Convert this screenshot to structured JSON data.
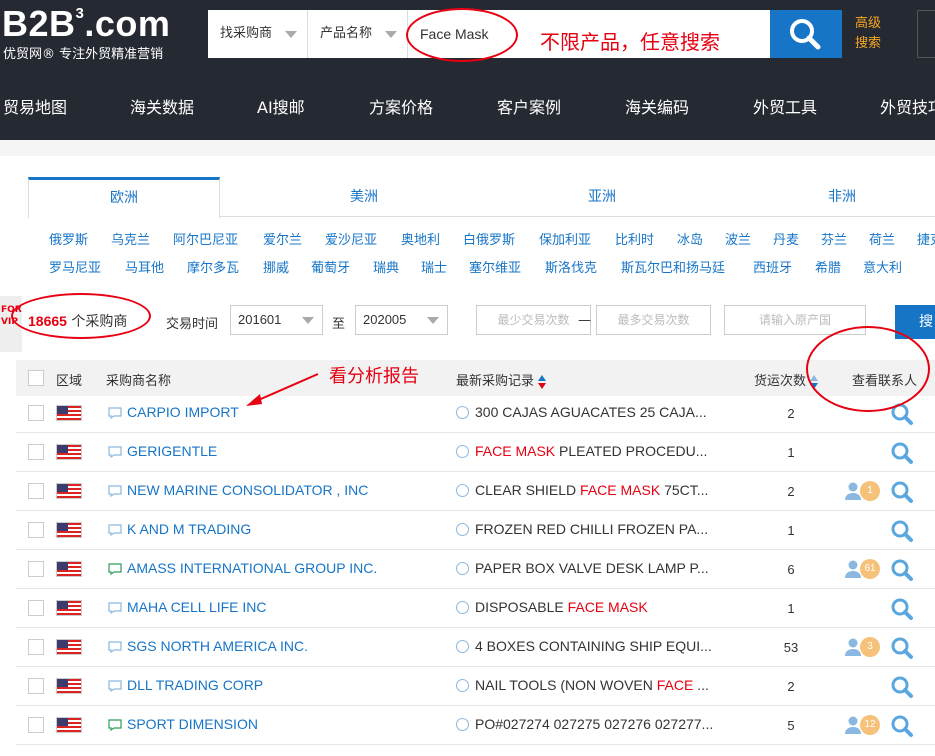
{
  "header": {
    "logo": "B2B",
    "logo_sup": "3",
    "logo_suffix": ".com",
    "logo_sub": "优贸网® 专注外贸精准营销",
    "search_type": "找采购商",
    "search_field": "产品名称",
    "search_query": "Face Mask",
    "callout": "不限产品，任意搜索",
    "advanced_search_line1": "高级",
    "advanced_search_line2": "搜索"
  },
  "nav": [
    "贸易地图",
    "海关数据",
    "AI搜邮",
    "方案价格",
    "客户案例",
    "海关编码",
    "外贸工具",
    "外贸技巧"
  ],
  "region_tabs": [
    "欧洲",
    "美洲",
    "亚洲",
    "非洲"
  ],
  "countries_row1": [
    "俄罗斯",
    "乌克兰",
    "阿尔巴尼亚",
    "爱尔兰",
    "爱沙尼亚",
    "奥地利",
    "白俄罗斯",
    "保加利亚",
    "比利时",
    "冰岛",
    "波兰",
    "丹麦",
    "芬兰",
    "荷兰",
    "捷克"
  ],
  "countries_row2": [
    "罗马尼亚",
    "马耳他",
    "摩尔多瓦",
    "挪威",
    "葡萄牙",
    "瑞典",
    "瑞士",
    "塞尔维亚",
    "斯洛伐克",
    "斯瓦尔巴和扬马廷",
    "西班牙",
    "希腊",
    "意大利"
  ],
  "filters": {
    "vip_line1": "FOR",
    "vip_line2": "VIP",
    "count": "18665",
    "count_unit": "个采购商",
    "time_label": "交易时间",
    "from": "201601",
    "to_label": "至",
    "to": "202005",
    "min_placeholder": "最少交易次数",
    "dash": "—",
    "max_placeholder": "最多交易次数",
    "country_placeholder": "请输入原产国",
    "search_btn": "搜"
  },
  "table": {
    "columns": [
      "区域",
      "采购商名称",
      "最新采购记录",
      "货运次数",
      "查看联系人"
    ],
    "annotation": "看分析报告",
    "rows": [
      {
        "buyer": "CARPIO IMPORT",
        "rec_pre": "300 CAJAS AGUACATES 25 CAJA...",
        "rec_red": "",
        "rec_post": "",
        "shipments": "2",
        "contacts": ""
      },
      {
        "buyer": "GERIGENTLE",
        "rec_pre": "",
        "rec_red": "FACE MASK",
        "rec_post": " PLEATED PROCEDU...",
        "shipments": "1",
        "contacts": ""
      },
      {
        "buyer": "NEW MARINE CONSOLIDATOR , INC",
        "rec_pre": "CLEAR SHIELD ",
        "rec_red": "FACE MASK",
        "rec_post": " 75CT...",
        "shipments": "2",
        "contacts": "1"
      },
      {
        "buyer": "K AND M TRADING",
        "rec_pre": "FROZEN RED CHILLI FROZEN PA...",
        "rec_red": "",
        "rec_post": "",
        "shipments": "1",
        "contacts": ""
      },
      {
        "buyer": "AMASS INTERNATIONAL GROUP INC.",
        "rec_pre": "PAPER BOX VALVE DESK LAMP P...",
        "rec_red": "",
        "rec_post": "",
        "shipments": "6",
        "contacts": "61"
      },
      {
        "buyer": "MAHA CELL LIFE INC",
        "rec_pre": "DISPOSABLE ",
        "rec_red": "FACE MASK",
        "rec_post": "",
        "shipments": "1",
        "contacts": ""
      },
      {
        "buyer": "SGS NORTH AMERICA INC.",
        "rec_pre": "4 BOXES CONTAINING SHIP EQUI...",
        "rec_red": "",
        "rec_post": "",
        "shipments": "53",
        "contacts": "3"
      },
      {
        "buyer": "DLL TRADING CORP",
        "rec_pre": "NAIL TOOLS (NON WOVEN ",
        "rec_red": "FACE",
        "rec_post": " ...",
        "shipments": "2",
        "contacts": ""
      },
      {
        "buyer": "SPORT DIMENSION",
        "rec_pre": "PO#027274 027275 027276 027277...",
        "rec_red": "",
        "rec_post": "",
        "shipments": "5",
        "contacts": "12"
      }
    ]
  },
  "colors": {
    "accent": "#1775c8",
    "header_bg": "#252932",
    "highlight": "#e60012",
    "badge": "#f6c27a"
  }
}
